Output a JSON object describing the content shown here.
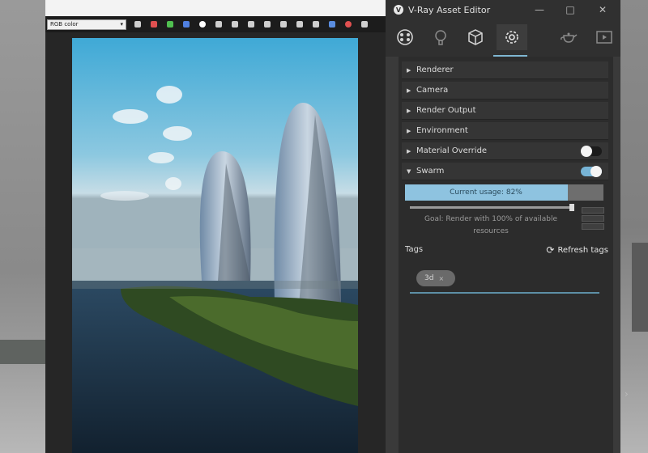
{
  "vfb": {
    "channel": "RGB color",
    "toolbar_icons": [
      "filter-icon",
      "red-channel-icon",
      "green-channel-icon",
      "blue-channel-icon",
      "white-dot-icon",
      "alpha-icon",
      "save-icon",
      "clear-icon",
      "lens-icon",
      "history-icon",
      "compare-icon",
      "region-icon",
      "track-icon",
      "stop-icon",
      "render-icon"
    ]
  },
  "editor": {
    "title": "V-Ray Asset Editor",
    "logo_glyph": "V",
    "minimize_glyph": "—",
    "maximize_glyph": "□",
    "close_glyph": "✕",
    "tabs": [
      {
        "name": "materials-tab",
        "icon": "materials-icon"
      },
      {
        "name": "lights-tab",
        "icon": "bulb-icon"
      },
      {
        "name": "geometry-tab",
        "icon": "cube-icon"
      },
      {
        "name": "settings-tab",
        "icon": "gear-icon"
      },
      {
        "name": "render-tab",
        "icon": "teapot-icon"
      },
      {
        "name": "frame-buffer-tab",
        "icon": "frame-buffer-icon"
      }
    ],
    "rollouts": [
      {
        "label": "Renderer"
      },
      {
        "label": "Camera"
      },
      {
        "label": "Render Output"
      },
      {
        "label": "Environment"
      },
      {
        "label": "Material Override",
        "toggle": false
      },
      {
        "label": "Swarm",
        "toggle": true
      }
    ],
    "arrow_collapsed": "▶",
    "arrow_expanded": "▼",
    "swarm": {
      "usage_label": "Current usage: 82%",
      "usage_percent": 82,
      "goal_text": "Goal: Render with 100% of available resources",
      "goal_percent": 100
    },
    "tags_label": "Tags",
    "refresh_label": "Refresh tags",
    "refresh_glyph": "⟳",
    "tag_chip": "3d",
    "tag_remove": "×",
    "side_arrow": "›"
  },
  "colors": {
    "accent": "#77b4d6",
    "panel": "#2c2c2c"
  }
}
